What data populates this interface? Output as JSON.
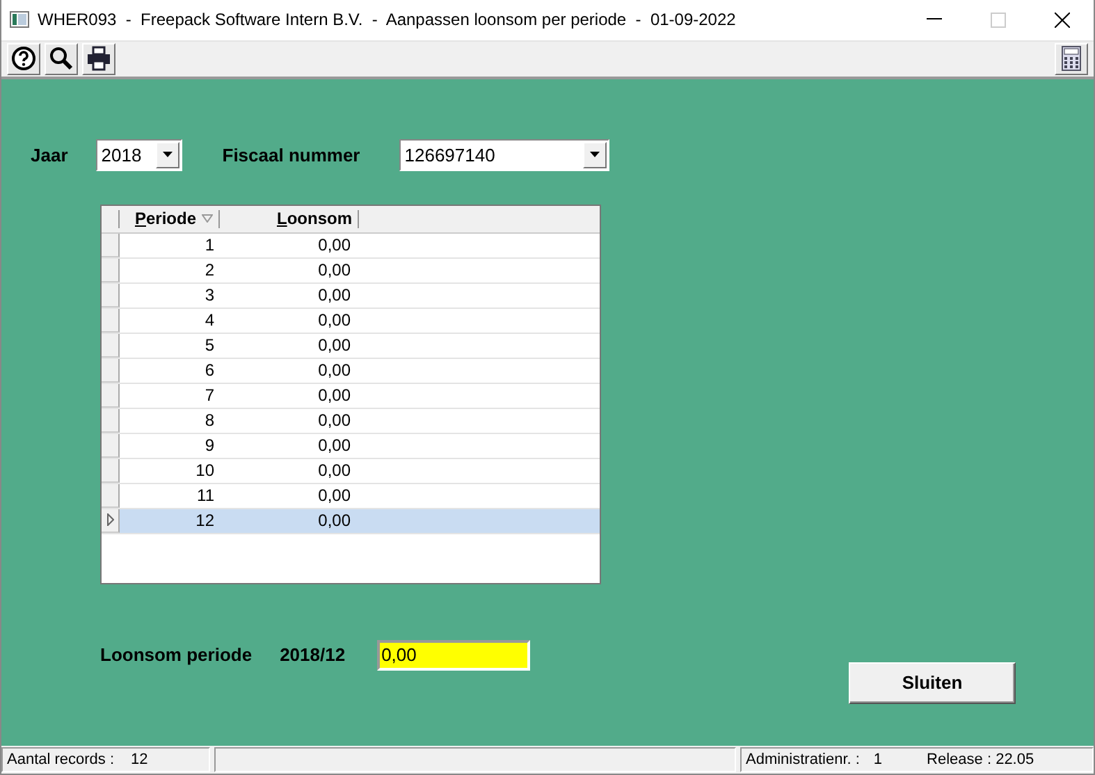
{
  "window": {
    "title": "WHER093  -  Freepack Software Intern B.V.  -  Aanpassen loonsom per periode  -  01-09-2022"
  },
  "filters": {
    "year_label": "Jaar",
    "year": "2018",
    "fiscal_label": "Fiscaal nummer",
    "fiscal_number": "126697140"
  },
  "table": {
    "columns": [
      {
        "label": "Periode",
        "sorted": true
      },
      {
        "label": "Loonsom",
        "sorted": false
      }
    ],
    "rows": [
      {
        "periode": "1",
        "loonsom": "0,00",
        "selected": false
      },
      {
        "periode": "2",
        "loonsom": "0,00",
        "selected": false
      },
      {
        "periode": "3",
        "loonsom": "0,00",
        "selected": false
      },
      {
        "periode": "4",
        "loonsom": "0,00",
        "selected": false
      },
      {
        "periode": "5",
        "loonsom": "0,00",
        "selected": false
      },
      {
        "periode": "6",
        "loonsom": "0,00",
        "selected": false
      },
      {
        "periode": "7",
        "loonsom": "0,00",
        "selected": false
      },
      {
        "periode": "8",
        "loonsom": "0,00",
        "selected": false
      },
      {
        "periode": "9",
        "loonsom": "0,00",
        "selected": false
      },
      {
        "periode": "10",
        "loonsom": "0,00",
        "selected": false
      },
      {
        "periode": "11",
        "loonsom": "0,00",
        "selected": false
      },
      {
        "periode": "12",
        "loonsom": "0,00",
        "selected": true
      }
    ]
  },
  "edit": {
    "label": "Loonsom periode",
    "period": "2018/12",
    "value": "0,00"
  },
  "buttons": [
    "Sluiten"
  ],
  "status_bar": {
    "records_label": "Aantal records :",
    "records": "12",
    "admin_label": "Administratienr. :",
    "admin": "1",
    "release": "Release : 22.05"
  }
}
